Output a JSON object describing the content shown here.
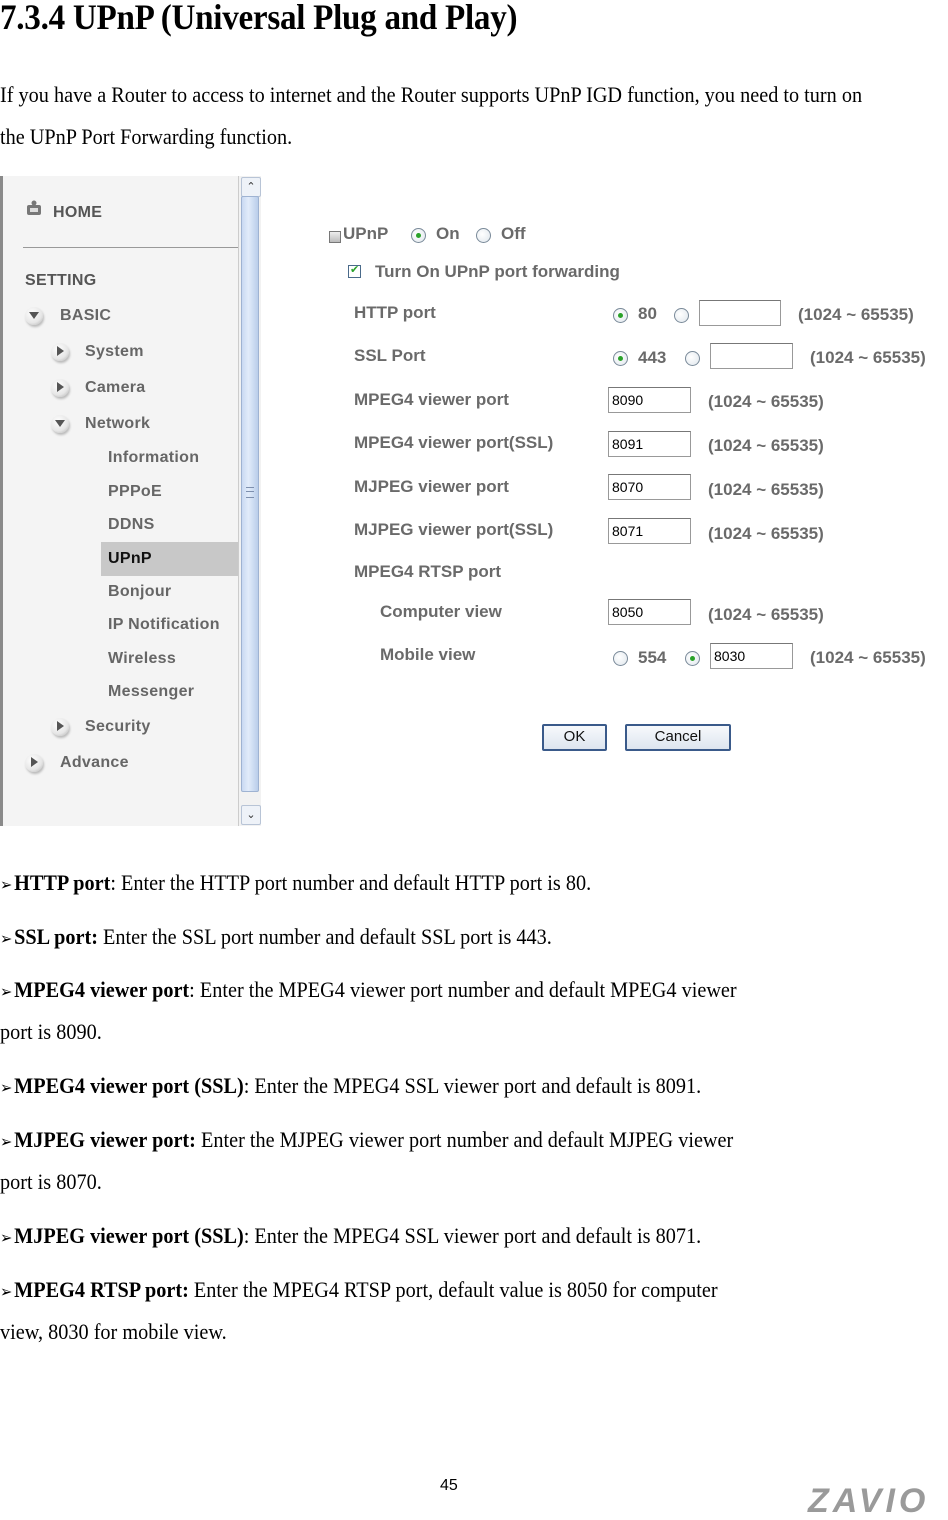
{
  "heading": "7.3.4 UPnP (Universal Plug and Play)",
  "intro": "If you have a Router to access to internet and the Router supports UPnP IGD function, you need to turn on the UPnP Port Forwarding function.",
  "sidebar": {
    "home": "HOME",
    "setting": "SETTING",
    "basic": "BASIC",
    "items": [
      {
        "label": "System"
      },
      {
        "label": "Camera"
      },
      {
        "label": "Network"
      },
      {
        "label": "Information"
      },
      {
        "label": "PPPoE"
      },
      {
        "label": "DDNS"
      },
      {
        "label": "UPnP",
        "selected": true
      },
      {
        "label": "Bonjour"
      },
      {
        "label": "IP Notification"
      },
      {
        "label": "Wireless"
      },
      {
        "label": "Messenger"
      },
      {
        "label": "Security"
      },
      {
        "label": "Advance"
      }
    ]
  },
  "form": {
    "upnp_label": "UPnP",
    "on_label": "On",
    "off_label": "Off",
    "upnp_state": "On",
    "forwarding_label": "Turn On UPnP port forwarding",
    "forwarding_checked": true,
    "range": "(1024 ~ 65535)",
    "http": {
      "label": "HTTP port",
      "default_option": "80",
      "selected": "80",
      "custom_value": ""
    },
    "ssl": {
      "label": "SSL Port",
      "default_option": "443",
      "selected": "443",
      "custom_value": ""
    },
    "mpeg4_viewer": {
      "label": "MPEG4 viewer port",
      "value": "8090"
    },
    "mpeg4_viewer_ssl": {
      "label": "MPEG4 viewer port(SSL)",
      "value": "8091"
    },
    "mjpeg_viewer": {
      "label": "MJPEG viewer port",
      "value": "8070"
    },
    "mjpeg_viewer_ssl": {
      "label": "MJPEG viewer port(SSL)",
      "value": "8071"
    },
    "rtsp": {
      "label": "MPEG4 RTSP port",
      "computer_view": {
        "label": "Computer view",
        "value": "8050"
      },
      "mobile_view": {
        "label": "Mobile view",
        "default_option": "554",
        "selected": "custom",
        "custom_value": "8030"
      }
    },
    "ok_label": "OK",
    "cancel_label": "Cancel"
  },
  "notes": [
    {
      "term": "HTTP port",
      "sep": ": ",
      "text": "Enter the HTTP port number and default HTTP port is 80."
    },
    {
      "term": "SSL port:",
      "sep": " ",
      "text": "Enter the SSL port number and default SSL port is 443."
    },
    {
      "term": "MPEG4 viewer port",
      "sep": ": ",
      "text": "Enter the MPEG4 viewer port number and default MPEG4 viewer",
      "cont": "port is 8090."
    },
    {
      "term": "MPEG4 viewer port (SSL)",
      "sep": ": ",
      "text": "Enter the MPEG4 SSL viewer port and default is 8091."
    },
    {
      "term": "MJPEG viewer port:",
      "sep": " ",
      "text": "Enter the MJPEG viewer port number and default MJPEG viewer",
      "cont": "port is 8070."
    },
    {
      "term": "MJPEG viewer port (SSL)",
      "sep": ": ",
      "text": "Enter the MPEG4 SSL viewer port and default is 8071."
    },
    {
      "term": "MPEG4 RTSP port:",
      "sep": " ",
      "text": "Enter the MPEG4 RTSP port, default value is 8050 for computer",
      "cont": "view, 8030 for mobile view."
    }
  ],
  "bullet_glyph": "➢",
  "page_number": "45",
  "logo": "ZAVIO"
}
